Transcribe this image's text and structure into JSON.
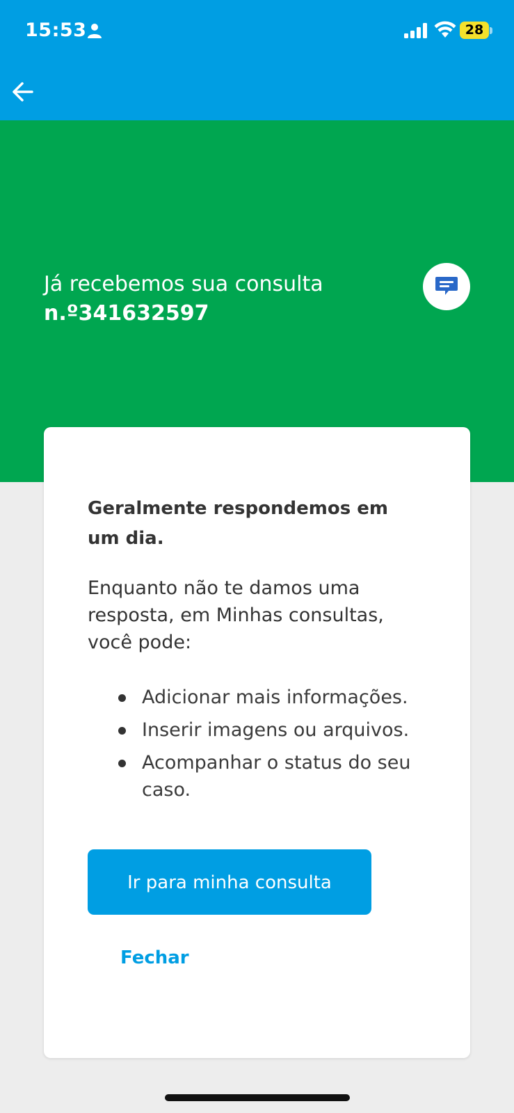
{
  "status_bar": {
    "time": "15:53",
    "battery_level": "28"
  },
  "header": {
    "back_icon": "arrow-left-icon"
  },
  "hero": {
    "title_prefix": "Já recebemos sua consulta",
    "title_number": "n.º341632597",
    "badge_icon": "chat-message-icon"
  },
  "card": {
    "headline": "Geralmente respondemos em um dia.",
    "intro": "Enquanto não te damos uma resposta, em Minhas consultas, você pode:",
    "bullets": [
      "Adicionar mais informações.",
      "Inserir imagens ou arquivos.",
      "Acompanhar o status do seu caso."
    ],
    "primary_button": "Ir para minha consulta",
    "secondary_button": "Fechar"
  },
  "colors": {
    "top_bar": "#009ee3",
    "hero": "#00a650",
    "primary": "#009ee3",
    "background": "#ededed"
  }
}
